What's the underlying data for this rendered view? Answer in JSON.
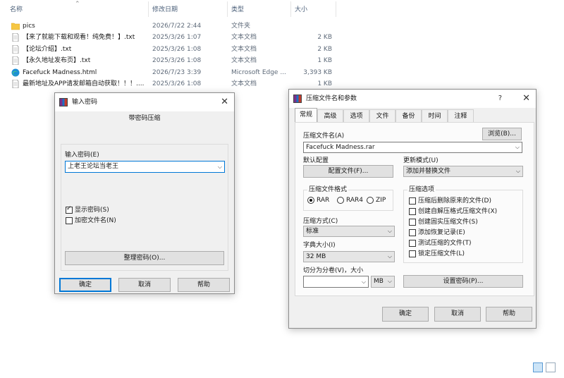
{
  "explorer": {
    "columns": {
      "name": "名称",
      "date": "修改日期",
      "type": "类型",
      "size": "大小"
    },
    "files": [
      {
        "name": "pics",
        "date": "2026/7/22 2:44",
        "type": "文件夹",
        "size": "",
        "icon": "folder-icon"
      },
      {
        "name": "【来了就能下载和观看！纯免费！】.txt",
        "date": "2025/3/26 1:07",
        "type": "文本文档",
        "size": "2 KB",
        "icon": "text-file-icon"
      },
      {
        "name": "【论坛介绍】.txt",
        "date": "2025/3/26 1:08",
        "type": "文本文档",
        "size": "2 KB",
        "icon": "text-file-icon"
      },
      {
        "name": "【永久地址发布页】.txt",
        "date": "2025/3/26 1:08",
        "type": "文本文档",
        "size": "1 KB",
        "icon": "text-file-icon"
      },
      {
        "name": "Facefuck Madness.html",
        "date": "2026/7/23 3:39",
        "type": "Microsoft Edge ...",
        "size": "3,393 KB",
        "icon": "edge-html-icon"
      },
      {
        "name": "最新地址及APP请发邮箱自动获取！！！....",
        "date": "2025/3/26 1:08",
        "type": "文本文档",
        "size": "1 KB",
        "icon": "text-file-icon"
      }
    ]
  },
  "password_dialog": {
    "title": "输入密码",
    "heading": "带密码压缩",
    "password_label": "输入密码(E)",
    "password_value": "上老王论坛当老王",
    "show_password_label": "显示密码(S)",
    "encrypt_names_label": "加密文件名(N)",
    "organize_button": "整理密码(O)...",
    "ok": "确定",
    "cancel": "取消",
    "help": "帮助"
  },
  "archive_dialog": {
    "title": "压缩文件名和参数",
    "help_glyph": "?",
    "tabs": [
      "常规",
      "高级",
      "选项",
      "文件",
      "备份",
      "时间",
      "注释"
    ],
    "archive_name_label": "压缩文件名(A)",
    "browse_button": "浏览(B)...",
    "archive_name_value": "Facefuck Madness.rar",
    "default_profile_label": "默认配置",
    "profile_button": "配置文件(F)...",
    "update_mode_label": "更新模式(U)",
    "update_mode_value": "添加并替换文件",
    "format_group_label": "压缩文件格式",
    "format_options": [
      "RAR",
      "RAR4",
      "ZIP"
    ],
    "options_group_label": "压缩选项",
    "options": [
      "压缩后删除原来的文件(D)",
      "创建自解压格式压缩文件(X)",
      "创建固实压缩文件(S)",
      "添加恢复记录(E)",
      "测试压缩的文件(T)",
      "锁定压缩文件(L)"
    ],
    "method_label": "压缩方式(C)",
    "method_value": "标准",
    "dict_label": "字典大小(I)",
    "dict_value": "32 MB",
    "split_label": "切分为分卷(V)，大小",
    "split_unit": "MB",
    "set_password_button": "设置密码(P)...",
    "ok": "确定",
    "cancel": "取消",
    "help": "帮助"
  }
}
